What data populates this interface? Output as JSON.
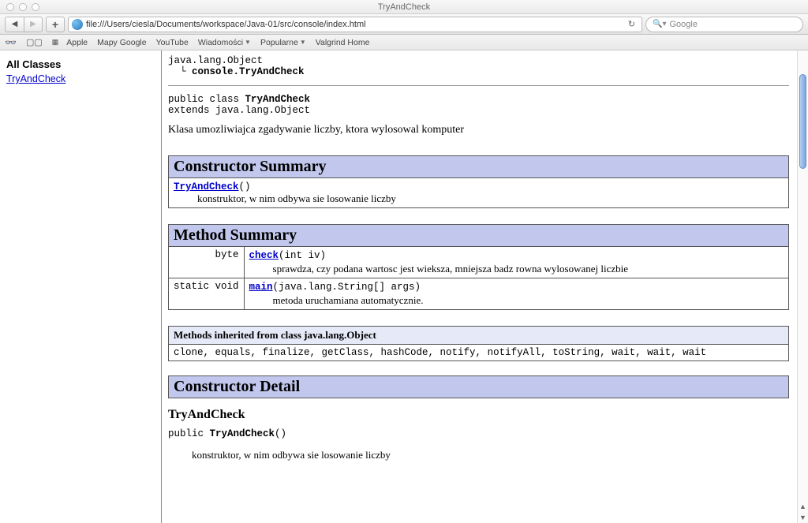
{
  "window": {
    "title": "TryAndCheck"
  },
  "toolbar": {
    "url": "file:///Users/ciesla/Documents/workspace/Java-01/src/console/index.html",
    "search_placeholder": "Google"
  },
  "bookmarks": {
    "items": [
      "Apple",
      "Mapy Google",
      "YouTube",
      "Wiadomości",
      "Popularne",
      "Valgrind Home"
    ]
  },
  "sidebar": {
    "heading": "All Classes",
    "links": [
      "TryAndCheck"
    ]
  },
  "javadoc": {
    "inheritance": "java.lang.Object\n  └ console.TryAndCheck",
    "declaration_line1": "public class ",
    "declaration_class": "TryAndCheck",
    "declaration_line2": "extends java.lang.Object",
    "description": "Klasa umozliwiajca zgadywanie liczby, ktora wylosowal komputer",
    "constructor_summary": {
      "title": "Constructor Summary",
      "rows": [
        {
          "sig_name": "TryAndCheck",
          "sig_args": "()",
          "desc": "konstruktor, w nim odbywa sie losowanie liczby"
        }
      ]
    },
    "method_summary": {
      "title": "Method Summary",
      "rows": [
        {
          "modifier": "byte",
          "name": "check",
          "args": "(int iv)",
          "desc": "sprawdza, czy podana wartosc jest wieksza, mniejsza badz rowna wylosowanej liczbie"
        },
        {
          "modifier": "static void",
          "name": "main",
          "args": "(java.lang.String[] args)",
          "desc": "metoda uruchamiana automatycznie."
        }
      ]
    },
    "inherited": {
      "title": "Methods inherited from class java.lang.Object",
      "list": "clone, equals, finalize, getClass, hashCode, notify, notifyAll, toString, wait, wait, wait"
    },
    "constructor_detail": {
      "title": "Constructor Detail",
      "name": "TryAndCheck",
      "signature": "public TryAndCheck()",
      "desc": "konstruktor, w nim odbywa sie losowanie liczby"
    }
  }
}
